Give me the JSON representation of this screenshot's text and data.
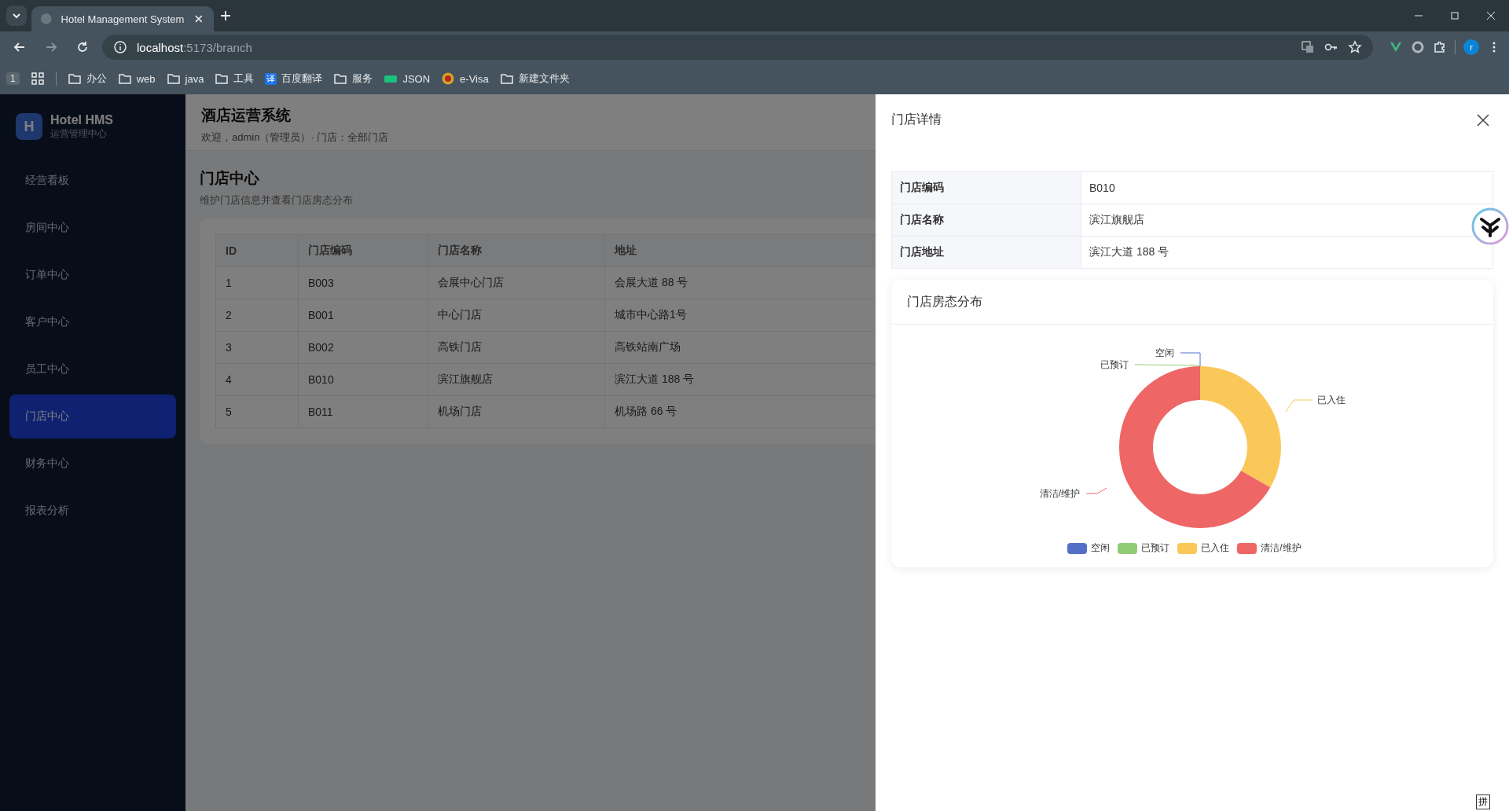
{
  "browser": {
    "tab_title": "Hotel Management System",
    "url_host": "localhost",
    "url_path": ":5173/branch",
    "profile_initial": "r",
    "tab_group": "1",
    "bookmarks": [
      {
        "label": "办公",
        "kind": "folder"
      },
      {
        "label": "web",
        "kind": "folder"
      },
      {
        "label": "java",
        "kind": "folder"
      },
      {
        "label": "工具",
        "kind": "folder"
      },
      {
        "label": "百度翻译",
        "kind": "translate",
        "glyph": "译"
      },
      {
        "label": "服务",
        "kind": "folder"
      },
      {
        "label": "JSON",
        "kind": "json"
      },
      {
        "label": "e-Visa",
        "kind": "visa"
      },
      {
        "label": "新建文件夹",
        "kind": "folder"
      }
    ]
  },
  "sidebar": {
    "logo_letter": "H",
    "brand": "Hotel HMS",
    "subtitle": "运营管理中心",
    "items": [
      {
        "label": "经营看板",
        "selected": false
      },
      {
        "label": "房间中心",
        "selected": false
      },
      {
        "label": "订单中心",
        "selected": false
      },
      {
        "label": "客户中心",
        "selected": false
      },
      {
        "label": "员工中心",
        "selected": false
      },
      {
        "label": "门店中心",
        "selected": true
      },
      {
        "label": "财务中心",
        "selected": false
      },
      {
        "label": "报表分析",
        "selected": false
      }
    ]
  },
  "header": {
    "title": "酒店运营系统",
    "welcome": "欢迎，admin（管理员）· 门店：全部门店"
  },
  "page": {
    "title": "门店中心",
    "subtitle": "维护门店信息并查看门店房态分布"
  },
  "table": {
    "columns": [
      "ID",
      "门店编码",
      "门店名称",
      "地址"
    ],
    "rows": [
      [
        "1",
        "B003",
        "会展中心门店",
        "会展大道 88 号"
      ],
      [
        "2",
        "B001",
        "中心门店",
        "城市中心路1号"
      ],
      [
        "3",
        "B002",
        "高铁门店",
        "高铁站南广场"
      ],
      [
        "4",
        "B010",
        "滨江旗舰店",
        "滨江大道 188 号"
      ],
      [
        "5",
        "B011",
        "机场门店",
        "机场路 66 号"
      ]
    ]
  },
  "drawer": {
    "title": "门店详情",
    "details": [
      {
        "label": "门店编码",
        "value": "B010"
      },
      {
        "label": "门店名称",
        "value": "滨江旗舰店"
      },
      {
        "label": "门店地址",
        "value": "滨江大道 188 号"
      }
    ],
    "chart_card": {
      "title": "门店房态分布",
      "chart_data": {
        "type": "donut",
        "categories": [
          "空闲",
          "已预订",
          "已入住",
          "清洁/维护"
        ],
        "legend": true,
        "series": [
          {
            "colors": [
              "#5470c6",
              "#91cc75",
              "#fac858",
              "#ee6666"
            ],
            "values": [
              0,
              0,
              33.3,
              66.7
            ]
          }
        ]
      }
    }
  },
  "ime_indicator": "拼"
}
